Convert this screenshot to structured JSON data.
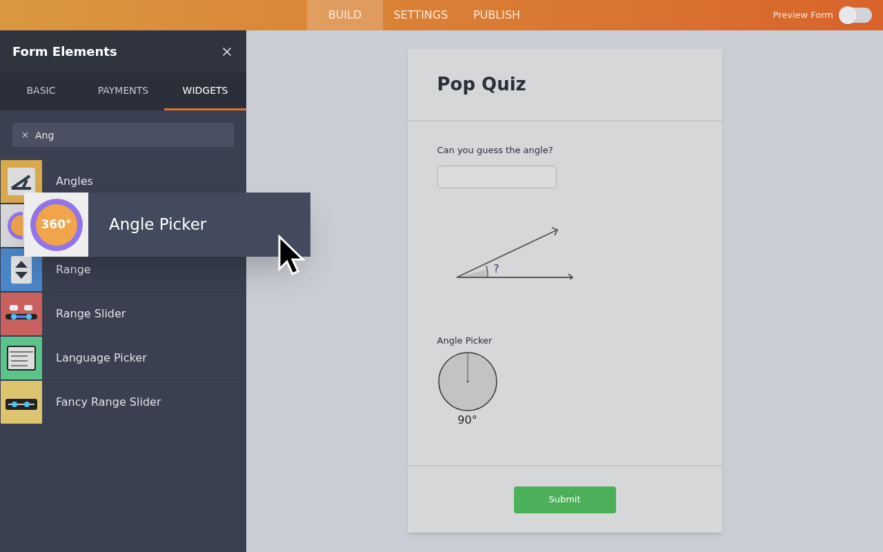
{
  "topbar": {
    "tabs": [
      {
        "label": "BUILD",
        "selected": true
      },
      {
        "label": "SETTINGS",
        "selected": false
      },
      {
        "label": "PUBLISH",
        "selected": false
      }
    ],
    "preview": {
      "label": "Preview Form",
      "on": false
    }
  },
  "sidebar": {
    "title": "Form Elements",
    "tabs": [
      {
        "label": "BASIC",
        "selected": false
      },
      {
        "label": "PAYMENTS",
        "selected": false
      },
      {
        "label": "WIDGETS",
        "selected": true
      }
    ],
    "search": {
      "value": "Ang"
    },
    "items": [
      {
        "kind": "angles",
        "label": "Angles",
        "color": "#d9a94e"
      },
      {
        "kind": "picker360",
        "color": "#d7d7d9"
      },
      {
        "kind": "range",
        "label": "Range",
        "color": "#4a86c8"
      },
      {
        "kind": "rangeslider",
        "label": "Range Slider",
        "color": "#c9625e"
      },
      {
        "kind": "language",
        "label": "Language Picker",
        "color": "#5cc48a"
      },
      {
        "kind": "fancyslider",
        "label": "Fancy Range Slider",
        "color": "#dcc56e"
      }
    ]
  },
  "drag": {
    "icon_text": "360°",
    "label": "Angle Picker"
  },
  "form": {
    "title": "Pop Quiz",
    "question": "Can you guess the angle?",
    "angle_mark": "?",
    "picker_label": "Angle Picker",
    "picker_value": "90°",
    "submit": "Submit"
  }
}
